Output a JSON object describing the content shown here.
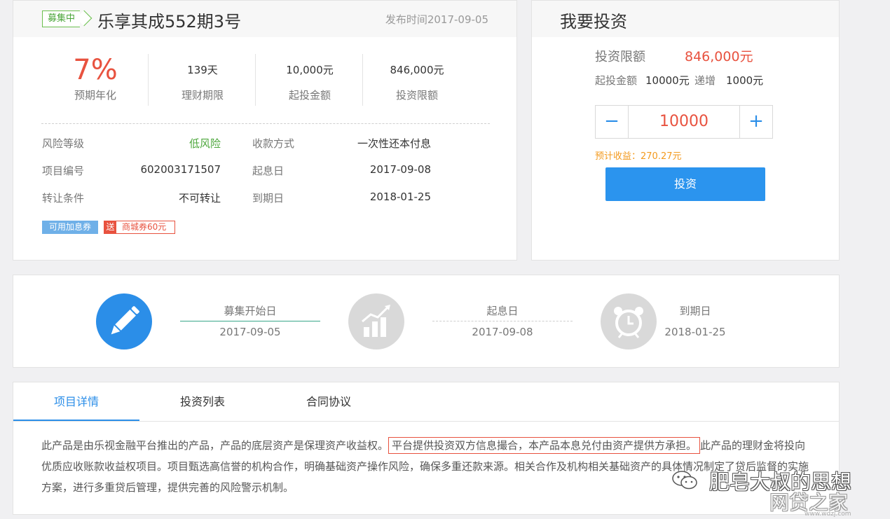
{
  "product": {
    "status_badge": "募集中",
    "title": "乐享其成552期3号",
    "publish_time": "发布时间2017-09-05",
    "stats": [
      {
        "value": "7%",
        "label": "预期年化"
      },
      {
        "value": "139天",
        "label": "理财期限"
      },
      {
        "value": "10,000元",
        "label": "起投金额"
      },
      {
        "value": "846,000元",
        "label": "投资限额"
      }
    ],
    "info": {
      "risk_level_label": "风险等级",
      "risk_level": "低风险",
      "payback_label": "收款方式",
      "payback": "一次性还本付息",
      "code_label": "项目编号",
      "code": "602003171507",
      "value_date_label": "起息日",
      "value_date": "2017-09-08",
      "transfer_label": "转让条件",
      "transfer": "不可转让",
      "due_date_label": "到期日",
      "due_date": "2018-01-25"
    },
    "tags": {
      "coupon": "可用加息券",
      "gift_prefix": "送",
      "gift": "商城券60元"
    }
  },
  "invest": {
    "title": "我要投资",
    "limit_label": "投资限额",
    "limit_value": "846,000元",
    "min_label": "起投金额",
    "min_value": "10000元",
    "step_label": "递增",
    "step_value": "1000元",
    "minus_symbol": "−",
    "plus_symbol": "+",
    "amount": "10000",
    "expected_income": "预计收益：270.27元",
    "button_label": "投资"
  },
  "timeline": {
    "start_label": "募集开始日",
    "start_date": "2017-09-05",
    "value_label": "起息日",
    "value_date": "2017-09-08",
    "due_label": "到期日",
    "due_date": "2018-01-25"
  },
  "details": {
    "tabs": [
      "项目详情",
      "投资列表",
      "合同协议"
    ],
    "desc_before": "此产品是由乐视金融平台推出的产品，产品的底层资产是保理资产收益权。",
    "desc_highlight": "平台提供投资双方信息撮合，本产品本息兑付由资产提供方承担。",
    "desc_after": "此产品的理财金将投向优质应收账款收益权项目。项目甄选高信誉的机构合作，明确基础资产操作风险，确保多重还款来源。相关合作及机构相关基础资产的具体情况制定了贷后监督的实施方案，进行多重贷后管理，提供完善的风险警示机制。"
  },
  "watermark": {
    "text": "肥皂大叔的思想",
    "site": "网贷之家",
    "domain": "www.wdzj.com"
  },
  "colors": {
    "accent_blue": "#2b8ee8",
    "accent_red": "#e8523f",
    "green": "#4ba63a",
    "orange": "#f39a1e"
  }
}
